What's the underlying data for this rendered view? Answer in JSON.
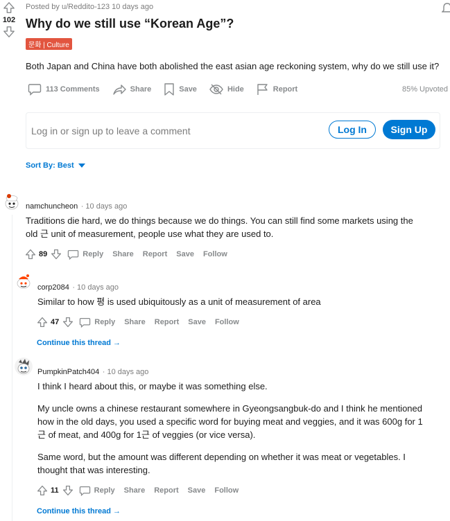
{
  "post": {
    "score": "102",
    "posted_by": "Posted by u/Reddito-123 10 days ago",
    "title": "Why do we still use “Korean Age”?",
    "flair": "문화 | Culture",
    "body": "Both Japan and China have both abolished the east asian age reckoning system, why do we still use it?",
    "actions": {
      "comments": "113 Comments",
      "share": "Share",
      "save": "Save",
      "hide": "Hide",
      "report": "Report"
    },
    "upvoted": "85% Upvoted"
  },
  "login": {
    "prompt": "Log in or sign up to leave a comment",
    "login_label": "Log In",
    "signup_label": "Sign Up"
  },
  "sort": {
    "label": "Sort By: Best"
  },
  "comments": [
    {
      "username": "namchuncheon",
      "time": "· 10 days ago",
      "lines": [
        "Traditions die hard, we do things because we do things. You can still find some markets using the",
        "old 근 unit of measurement, people use what they are used to."
      ],
      "score": "89",
      "actions": [
        "Reply",
        "Share",
        "Report",
        "Save",
        "Follow"
      ]
    },
    {
      "username": "corp2084",
      "time": "· 10 days ago",
      "lines": [
        "Similar to how 평 is used ubiquitously as a unit of measurement of area"
      ],
      "score": "47",
      "actions": [
        "Reply",
        "Share",
        "Report",
        "Save",
        "Follow"
      ],
      "continue": "Continue this thread"
    },
    {
      "username": "PumpkinPatch404",
      "time": "· 10 days ago",
      "paragraphs": [
        [
          "I think I heard about this, or maybe it was something else."
        ],
        [
          "My uncle owns a chinese restaurant somewhere in Gyeongsangbuk-do and I think he mentioned",
          "how in the old days, you used a specific word for buying meat and veggies, and it was 600g for 1",
          "근 of meat, and 400g for 1근 of veggies (or vice versa)."
        ],
        [
          "Same word, but the amount was different depending on whether it was meat or vegetables. I",
          "thought that was interesting."
        ]
      ],
      "score": "11",
      "actions": [
        "Reply",
        "Share",
        "Report",
        "Save",
        "Follow"
      ],
      "continue": "Continue this thread"
    }
  ],
  "colors": {
    "accent": "#0079d3",
    "flair": "#e2553f",
    "muted": "#878a8c"
  }
}
